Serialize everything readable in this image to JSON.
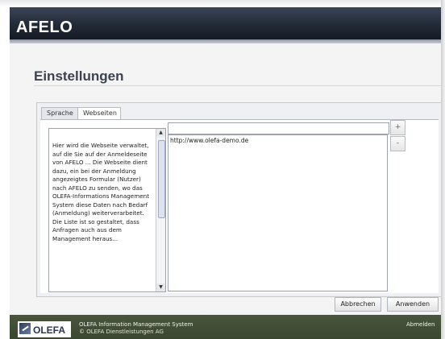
{
  "app": {
    "brand": "AFELO"
  },
  "page": {
    "title": "Einstellungen"
  },
  "tabs": [
    {
      "label": "Sprache"
    },
    {
      "label": "Webseiten"
    }
  ],
  "description": "Hier wird die Webseite verwaltet, auf die Sie auf der Anmeldeseite von AFELO ... Die Webseite dient dazu, ein bei der Anmeldung angezeigtes Formular (Nutzer) nach AFELO zu senden, wo das OLEFA-Informations Management System diese Daten nach Bedarf (Anmeldung) weiterverarbeitet. Die Liste ist so gestaltet, dass Anfragen auch aus dem Management heraus...",
  "url_list": {
    "input_value": "",
    "items": [
      "http://www.olefa-demo.de"
    ]
  },
  "controls": {
    "add_symbol": "+",
    "remove_symbol": "-",
    "cancel_label": "Abbrechen",
    "apply_label": "Anwenden"
  },
  "footer": {
    "logo_text": "OLEFA",
    "line1": "OLEFA Information Management System",
    "line2": "© OLEFA Dienstleistungen AG",
    "right_text": "Abmelden"
  }
}
